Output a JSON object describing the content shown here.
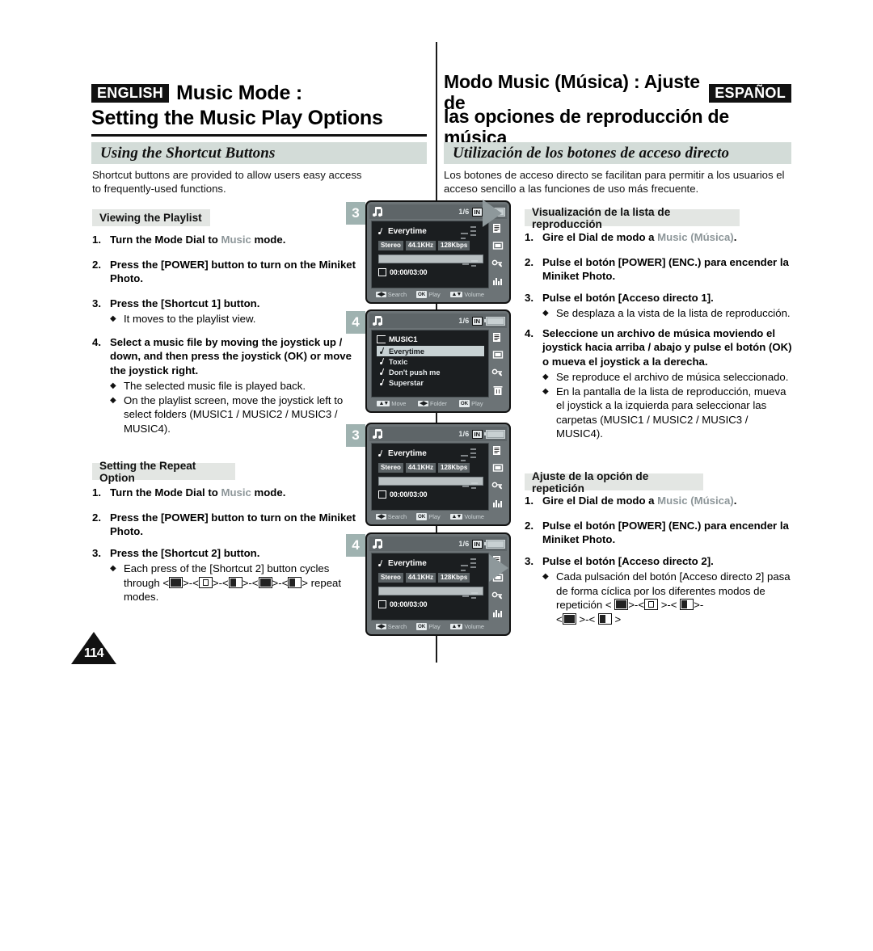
{
  "header": {
    "english": {
      "tag": "ENGLISH",
      "title_line1": "Music Mode :",
      "title_line2": "Setting the Music Play Options"
    },
    "spanish": {
      "tag": "ESPAÑOL",
      "title_line1": "Modo Music (Música) : Ajuste de",
      "title_line2": "las opciones de reproducción de música"
    }
  },
  "section": {
    "en_title": "Using the Shortcut Buttons",
    "es_title": "Utilización de los botones de acceso directo",
    "en_intro": "Shortcut buttons are provided to allow users easy access to frequently-used functions.",
    "es_intro": "Los botones de acceso directo se facilitan para permitir a los usuarios el acceso sencillo a las funciones de uso más frecuente."
  },
  "english": {
    "playlist_subhead": "Viewing the Playlist",
    "playlist_steps": {
      "s1_num": "1.",
      "s1_a": "Turn the Mode Dial to ",
      "s1_mode": "Music",
      "s1_b": " mode.",
      "s2_num": "2.",
      "s2": "Press the [POWER] button to turn on the Miniket Photo.",
      "s3_num": "3.",
      "s3": "Press the [Shortcut 1] button.",
      "s3_b1": "It moves to the playlist view.",
      "s4_num": "4.",
      "s4": "Select a music file by moving the joystick up / down, and then press the joystick (OK) or move the joystick right.",
      "s4_b1": "The selected music file is played back.",
      "s4_b2": "On the playlist screen, move the joystick left to select folders (MUSIC1 / MUSIC2 / MUSIC3 / MUSIC4)."
    },
    "repeat_subhead": "Setting the Repeat Option",
    "repeat_steps": {
      "r1_num": "1.",
      "r1_a": "Turn the Mode Dial to ",
      "r1_mode": "Music",
      "r1_b": " mode.",
      "r2_num": "2.",
      "r2": "Press the [POWER] button to turn on the Miniket Photo.",
      "r3_num": "3.",
      "r3": "Press the [Shortcut 2] button.",
      "r3_b1_pre": "Each press of the [Shortcut 2] button cycles through ",
      "r3_b1_post": " repeat modes."
    }
  },
  "spanish": {
    "playlist_subhead": "Visualización de la lista de reproducción",
    "playlist_steps": {
      "s1_num": "1.",
      "s1_a": "Gire el Dial de modo a ",
      "s1_mode": "Music (Música)",
      "s1_b": ".",
      "s2_num": "2.",
      "s2": "Pulse el botón [POWER] (ENC.) para encender la Miniket Photo.",
      "s3_num": "3.",
      "s3": "Pulse el botón [Acceso directo 1].",
      "s3_b1": "Se desplaza a la vista de la lista de reproducción.",
      "s4_num": "4.",
      "s4": "Seleccione un archivo de música moviendo el joystick hacia arriba / abajo y pulse el botón (OK) o mueva el joystick a la derecha.",
      "s4_b1": "Se reproduce el archivo de música seleccionado.",
      "s4_b2": "En la pantalla de la lista de reproducción, mueva el joystick a la izquierda para seleccionar las carpetas (MUSIC1 / MUSIC2 / MUSIC3 / MUSIC4)."
    },
    "repeat_subhead": "Ajuste de la opción de repetición",
    "repeat_steps": {
      "r1_num": "1.",
      "r1_a": "Gire el Dial de modo a ",
      "r1_mode": "Music (Música)",
      "r1_b": ".",
      "r2_num": "2.",
      "r2": "Pulse el botón [POWER] (ENC.) para encender la Miniket Photo.",
      "r3_num": "3.",
      "r3": "Pulse el botón [Acceso directo 2].",
      "r3_b1_pre": "Cada pulsación del botón [Acceso directo 2] pasa de forma cíclica por los diferentes modos de repetición ",
      "r3_b1_post": ""
    }
  },
  "screens": [
    {
      "badge": "3",
      "type": "now-playing",
      "track_index": "1/6",
      "storage": "IN",
      "title": "Everytime",
      "tags": [
        "Stereo",
        "44.1KHz",
        "128Kbps"
      ],
      "time": "00:00/03:00",
      "bottom": [
        {
          "key": "◀▶",
          "label": "Search"
        },
        {
          "key": "OK",
          "label": "Play"
        },
        {
          "key": "▲▼",
          "label": "Volume"
        }
      ],
      "show_play_arrow": true,
      "arrow_position": "top"
    },
    {
      "badge": "4",
      "type": "playlist",
      "track_index": "1/6",
      "storage": "IN",
      "folder": "MUSIC1",
      "items": [
        "Everytime",
        "Toxic",
        "Don't push me",
        "Superstar"
      ],
      "selected_index": 0,
      "bottom": [
        {
          "key": "▲▼",
          "label": "Move"
        },
        {
          "key": "◀▶",
          "label": "Folder"
        },
        {
          "key": "OK",
          "label": "Play"
        }
      ],
      "show_play_arrow": false
    },
    {
      "badge": "3",
      "type": "now-playing",
      "track_index": "1/6",
      "storage": "IN",
      "title": "Everytime",
      "tags": [
        "Stereo",
        "44.1KHz",
        "128Kbps"
      ],
      "time": "00:00/03:00",
      "bottom": [
        {
          "key": "◀▶",
          "label": "Search"
        },
        {
          "key": "OK",
          "label": "Play"
        },
        {
          "key": "▲▼",
          "label": "Volume"
        }
      ],
      "show_play_arrow": false
    },
    {
      "badge": "4",
      "type": "now-playing",
      "track_index": "1/6",
      "storage": "IN",
      "title": "Everytime",
      "tags": [
        "Stereo",
        "44.1KHz",
        "128Kbps"
      ],
      "time": "00:00/03:00",
      "bottom": [
        {
          "key": "◀▶",
          "label": "Search"
        },
        {
          "key": "OK",
          "label": "Play"
        },
        {
          "key": "▲▼",
          "label": "Volume"
        }
      ],
      "show_play_arrow": true,
      "arrow_position": "mid"
    }
  ],
  "rail_icons": [
    "file-list-icon",
    "repeat-icon",
    "sound-off-icon",
    "equalizer-icon"
  ],
  "rail_icons_playlist": [
    "file-list-icon",
    "repeat-icon",
    "sound-off-icon",
    "trash-icon"
  ],
  "page_number": "114",
  "colors": {
    "section_bar": "#d3dcd8",
    "subhead_bar": "#e3e6e3",
    "badge": "#9fb2b0",
    "mode_word": "#8d9699",
    "lcd_frame": "#6c7376",
    "lcd_screen": "#1b1e20"
  }
}
